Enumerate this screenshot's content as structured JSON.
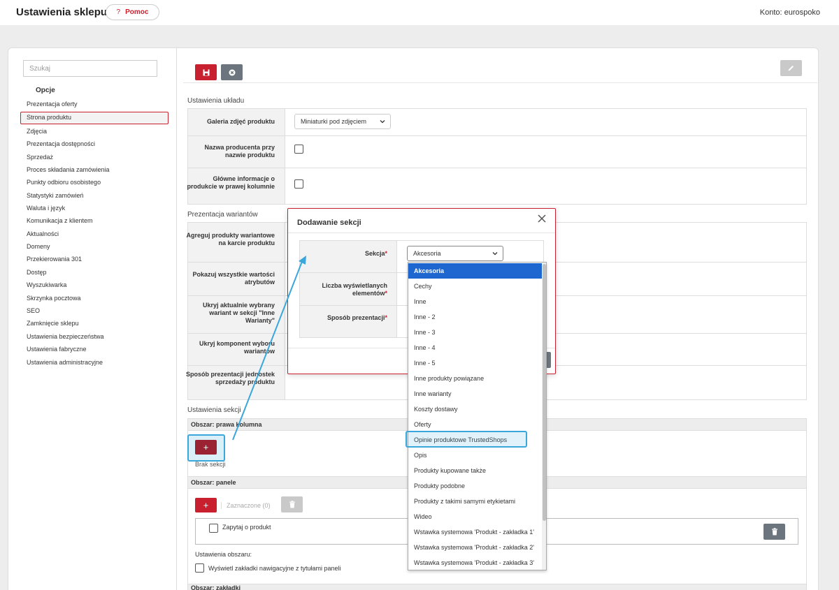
{
  "header": {
    "title": "Ustawienia sklepu",
    "help_label": "Pomoc",
    "help_icon_text": "?",
    "account_text": "Konto: eurospoko"
  },
  "sidebar": {
    "search_placeholder": "Szukaj",
    "section_title": "Opcje",
    "items": [
      {
        "label": "Prezentacja oferty"
      },
      {
        "label": "Strona produktu",
        "active": true
      },
      {
        "label": "Zdjęcia"
      },
      {
        "label": "Prezentacja dostępności"
      },
      {
        "label": "Sprzedaż"
      },
      {
        "label": "Proces składania zamówienia"
      },
      {
        "label": "Punkty odbioru osobistego"
      },
      {
        "label": "Statystyki zamówień"
      },
      {
        "label": "Waluta i język"
      },
      {
        "label": "Komunikacja z klientem"
      },
      {
        "label": "Aktualności"
      },
      {
        "label": "Domeny"
      },
      {
        "label": "Przekierowania 301"
      },
      {
        "label": "Dostęp"
      },
      {
        "label": "Wyszukiwarka"
      },
      {
        "label": "Skrzynka pocztowa"
      },
      {
        "label": "SEO"
      },
      {
        "label": "Zamknięcie sklepu"
      },
      {
        "label": "Ustawienia bezpieczeństwa"
      },
      {
        "label": "Ustawienia fabryczne"
      },
      {
        "label": "Ustawienia administracyjne"
      }
    ]
  },
  "layout_section": {
    "title": "Ustawienia układu",
    "gallery_label": "Galeria zdjęć produktu",
    "gallery_value": "Miniaturki pod zdjęciem",
    "producer_label": "Nazwa producenta przy nazwie produktu",
    "main_info_label": "Główne informacje o produkcie w prawej kolumnie"
  },
  "variants_section": {
    "title": "Prezentacja wariantów",
    "rows": [
      "Agreguj produkty wariantowe na karcie produktu",
      "Pokazuj wszystkie wartości atrybutów",
      "Ukryj aktualnie wybrany wariant w sekcji \"Inne Warianty\"",
      "Ukryj komponent wyboru wariantów",
      "Sposób prezentacji jednostek sprzedaży produktu"
    ]
  },
  "sections": {
    "title": "Ustawienia sekcji",
    "area_right": "Obszar: prawa kolumna",
    "plus_symbol": "+",
    "no_sections": "Brak sekcji",
    "area_panels": "Obszar: panele",
    "selected_count": "Zaznaczone (0)",
    "panel_item": "Zapytaj o produkt",
    "area_settings": "Ustawienia obszaru:",
    "show_tabs_label": "Wyświetl zakładki nawigacyjne z tytułami paneli",
    "area_tabs": "Obszar: zakładki"
  },
  "modal": {
    "title": "Dodawanie sekcji",
    "section_label": "Sekcja",
    "section_value": "Akcesoria",
    "count_label": "Liczba wyświetlanych elementów",
    "presentation_label": "Sposób prezentacji",
    "required_mark": "*"
  },
  "dropdown": {
    "options": [
      "Akcesoria",
      "Cechy",
      "Inne",
      "Inne - 2",
      "Inne - 3",
      "Inne - 4",
      "Inne - 5",
      "Inne produkty powiązane",
      "Inne warianty",
      "Koszty dostawy",
      "Oferty",
      "Opinie produktowe TrustedShops",
      "Opis",
      "Produkty kupowane także",
      "Produkty podobne",
      "Produkty z takimi samymi etykietami",
      "Wideo",
      "Wstawka systemowa 'Produkt - zakładka 1'",
      "Wstawka systemowa 'Produkt - zakładka 2'",
      "Wstawka systemowa 'Produkt - zakładka 3'"
    ],
    "selected": "Akcesoria",
    "highlighted": "Opinie produktowe TrustedShops"
  },
  "colors": {
    "brand_red": "#c8202f",
    "annotation_blue": "#3aa7db",
    "selected_blue": "#1e66d0"
  }
}
